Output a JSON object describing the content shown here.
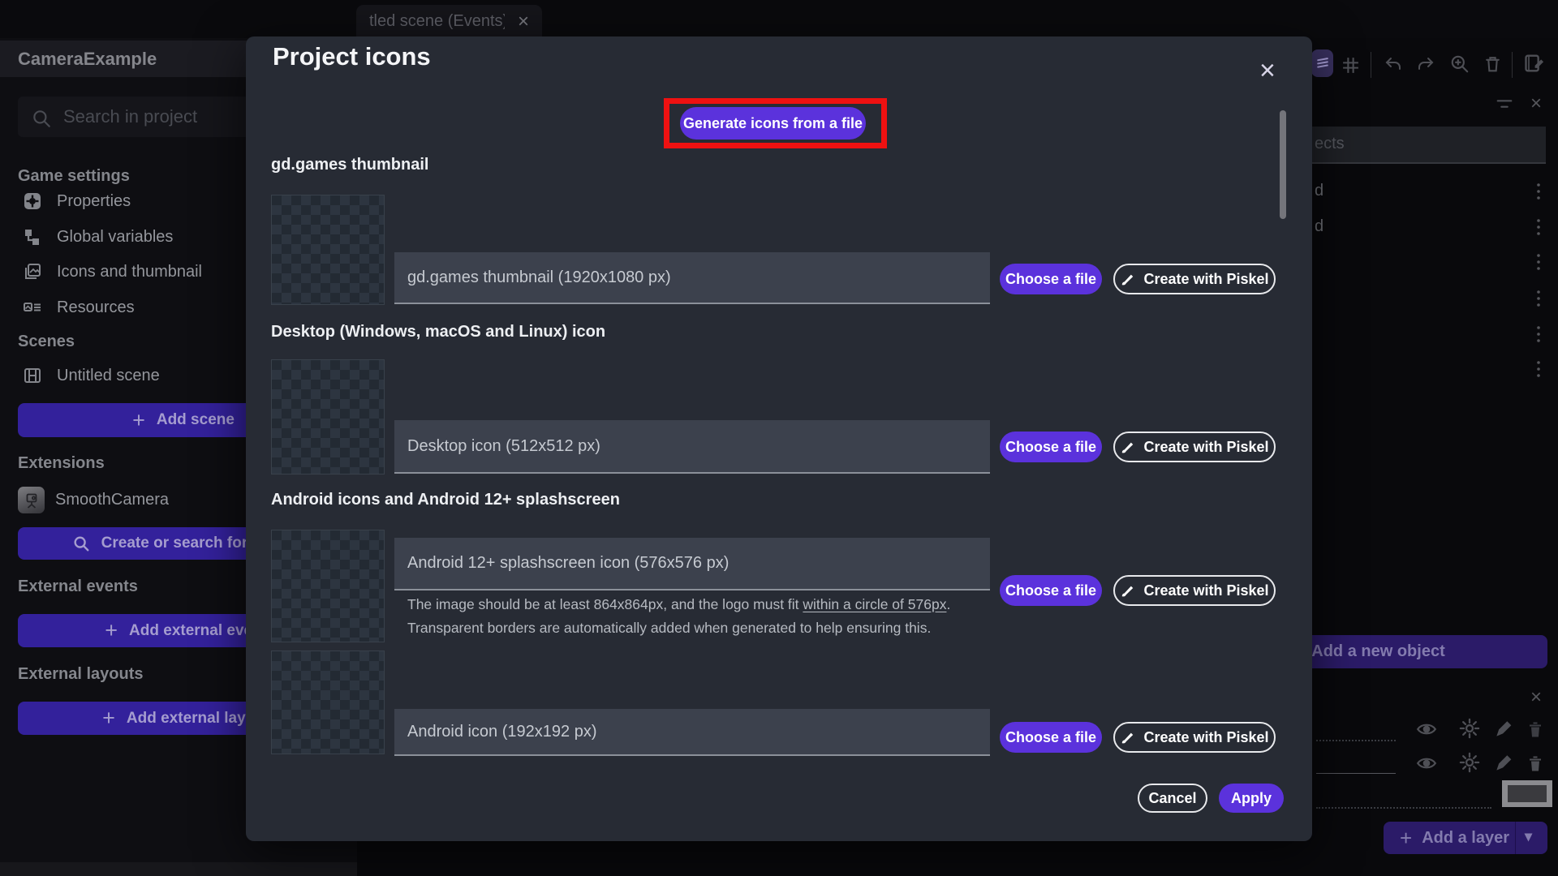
{
  "colors": {
    "accent_purple": "#5b32dc",
    "highlight_red": "#ee1111",
    "modal_bg": "#272b34",
    "field_bg": "#3c414d"
  },
  "topbar": {
    "tab_label": "tled scene (Events)",
    "tab_close_icon": "×"
  },
  "sidebar": {
    "project_name": "CameraExample",
    "search_placeholder": "Search in project",
    "game_settings": {
      "title": "Game settings",
      "items": [
        "Properties",
        "Global variables",
        "Icons and thumbnail",
        "Resources"
      ]
    },
    "scenes": {
      "title": "Scenes",
      "items": [
        "Untitled scene"
      ],
      "add_button": "Add scene"
    },
    "extensions": {
      "title": "Extensions",
      "items": [
        "SmoothCamera"
      ],
      "search_button": "Create or search for new e"
    },
    "external_events": {
      "title": "External events",
      "add_button": "Add external even"
    },
    "external_layouts": {
      "title": "External layouts",
      "add_button": "Add external layou"
    }
  },
  "right_panel": {
    "objects_header_fragment": "ects",
    "object_row_fragments": [
      "d",
      "d",
      "",
      "",
      "",
      ""
    ],
    "add_object_button": "Add a new object",
    "add_layer_button": "Add a layer",
    "layer_dropdown_icon": "▾",
    "panel_close_icon": "×",
    "layers_close_icon": "×"
  },
  "modal": {
    "title": "Project icons",
    "close_icon": "×",
    "generate_button": "Generate icons from a file",
    "buttons": {
      "choose": "Choose a file",
      "piskel": "Create with Piskel"
    },
    "sections": [
      {
        "label": "gd.games thumbnail",
        "field_placeholder": "gd.games thumbnail (1920x1080 px)"
      },
      {
        "label": "Desktop (Windows, macOS and Linux) icon",
        "field_placeholder": "Desktop icon (512x512 px)"
      },
      {
        "label": "Android icons and Android 12+ splashscreen",
        "field_placeholder": "Android 12+ splashscreen icon (576x576 px)",
        "helper_line1_pre": "The image should be at least 864x864px, and the logo must fit ",
        "helper_line1_underlined": "within a circle of 576px",
        "helper_line1_post": ".",
        "helper_line2": "Transparent borders are automatically added when generated to help ensuring this."
      },
      {
        "field_placeholder": "Android icon (192x192 px)"
      }
    ],
    "footer": {
      "cancel": "Cancel",
      "apply": "Apply"
    }
  }
}
